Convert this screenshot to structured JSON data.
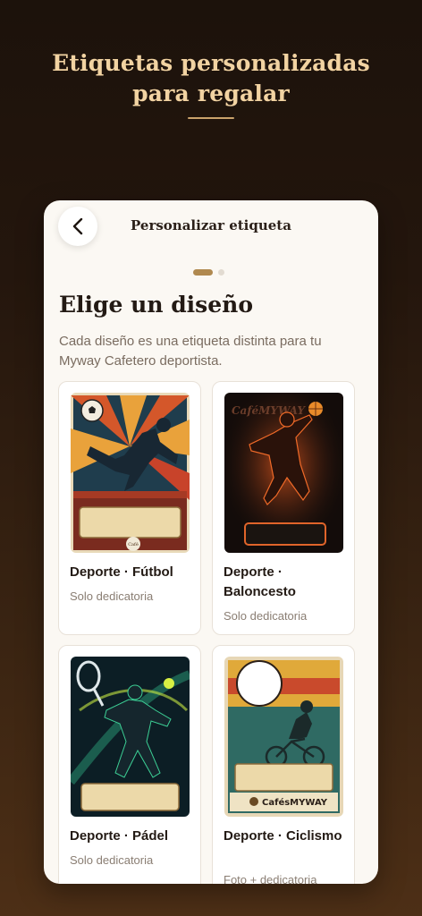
{
  "hero": {
    "line1": "Etiquetas personalizadas",
    "line2": "para regalar"
  },
  "header": {
    "title": "Personalizar etiqueta",
    "back_icon": "chevron-left-icon"
  },
  "pager": {
    "current": 1,
    "total": 2
  },
  "section": {
    "title": "Elige un diseño",
    "description": "Cada diseño es una etiqueta distinta para tu Myway Cafetero deportista."
  },
  "designs": [
    {
      "title": "Deporte · Fútbol",
      "subtitle": "Solo dedicatoria",
      "badge": "Café"
    },
    {
      "title": "Deporte · Baloncesto",
      "subtitle": "Solo dedicatoria",
      "brand": "CaféMYWAY"
    },
    {
      "title": "Deporte · Pádel",
      "subtitle": "Solo dedicatoria"
    },
    {
      "title": "Deporte · Ciclismo",
      "subtitle": "Foto + dedicatoria",
      "brand": "CafésMYWAY"
    }
  ],
  "colors": {
    "accent": "#b0894f",
    "hero_text": "#f2d3a2",
    "card_bg": "#fbf8f3"
  }
}
